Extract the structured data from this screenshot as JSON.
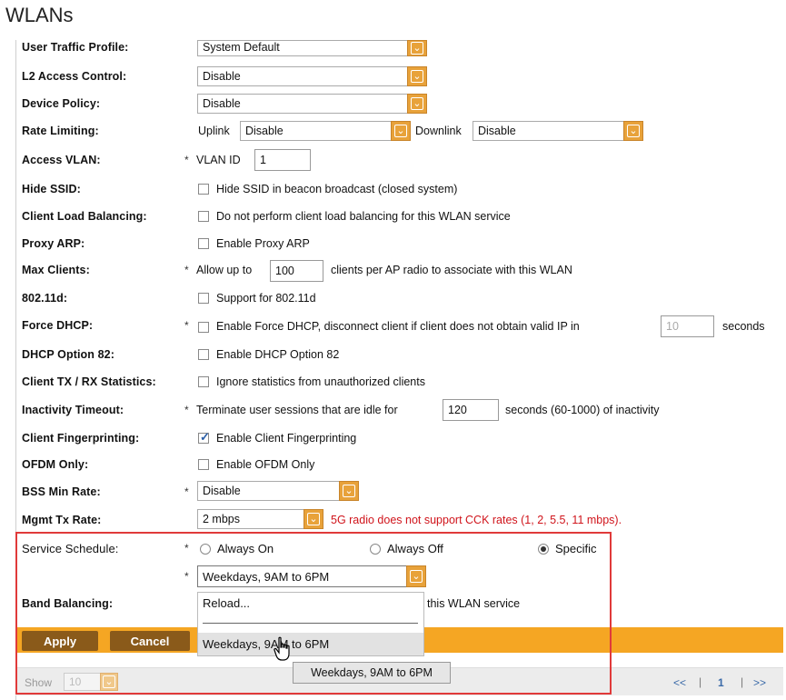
{
  "page": {
    "title": "WLANs"
  },
  "form": {
    "user_traffic_profile": {
      "label": "User Traffic Profile:",
      "value": "System Default"
    },
    "l2_access_control": {
      "label": "L2 Access Control:",
      "value": "Disable"
    },
    "device_policy": {
      "label": "Device Policy:",
      "value": "Disable"
    },
    "rate_limiting": {
      "label": "Rate Limiting:",
      "uplink_label": "Uplink",
      "uplink_value": "Disable",
      "downlink_label": "Downlink",
      "downlink_value": "Disable"
    },
    "access_vlan": {
      "label": "Access VLAN:",
      "star": "*",
      "vlan_id_label": "VLAN ID",
      "value": "1"
    },
    "hide_ssid": {
      "label": "Hide SSID:",
      "text": "Hide SSID in beacon broadcast (closed system)",
      "checked": false
    },
    "client_load_balancing": {
      "label": "Client Load Balancing:",
      "text": "Do not perform client load balancing for this WLAN service",
      "checked": false
    },
    "proxy_arp": {
      "label": "Proxy ARP:",
      "text": "Enable Proxy ARP",
      "checked": false
    },
    "max_clients": {
      "label": "Max Clients:",
      "star": "*",
      "prefix": "Allow up to",
      "value": "100",
      "suffix": "clients per AP radio to associate with this WLAN"
    },
    "dot11d": {
      "label": "802.11d:",
      "text": "Support for 802.11d",
      "checked": false
    },
    "force_dhcp": {
      "label": "Force DHCP:",
      "star": "*",
      "text": "Enable Force DHCP, disconnect client if client does not obtain valid IP in",
      "value": "10",
      "suffix": "seconds",
      "checked": false
    },
    "dhcp_option_82": {
      "label": "DHCP Option 82:",
      "text": "Enable DHCP Option 82",
      "checked": false
    },
    "client_stats": {
      "label": "Client TX / RX Statistics:",
      "text": "Ignore statistics from unauthorized clients",
      "checked": false
    },
    "inactivity_timeout": {
      "label": "Inactivity Timeout:",
      "star": "*",
      "prefix": "Terminate user sessions that are idle for",
      "value": "120",
      "suffix": "seconds (60-1000) of inactivity"
    },
    "client_fingerprinting": {
      "label": "Client Fingerprinting:",
      "text": "Enable Client Fingerprinting",
      "checked": true
    },
    "ofdm_only": {
      "label": "OFDM Only:",
      "text": "Enable OFDM Only",
      "checked": false
    },
    "bss_min_rate": {
      "label": "BSS Min Rate:",
      "star": "*",
      "value": "Disable"
    },
    "mgmt_tx_rate": {
      "label": "Mgmt Tx Rate:",
      "value": "2 mbps",
      "warning": "5G radio does not support CCK rates (1, 2, 5.5, 11 mbps)."
    },
    "service_schedule": {
      "label": "Service Schedule:",
      "star": "*",
      "always_on": "Always On",
      "always_off": "Always Off",
      "specific": "Specific",
      "selected": "Specific",
      "schedule_star": "*",
      "schedule_value": "Weekdays, 9AM to 6PM"
    },
    "band_balancing": {
      "label": "Band Balancing:",
      "text_tail": "this WLAN service"
    }
  },
  "dropdown": {
    "options": [
      "Reload...",
      "Weekdays, 9AM to 6PM"
    ],
    "highlighted": "Weekdays, 9AM to 6PM"
  },
  "tooltip": {
    "text": "Weekdays, 9AM to 6PM"
  },
  "actions": {
    "apply": "Apply",
    "cancel": "Cancel"
  },
  "footer": {
    "show_label": "Show",
    "show_value": "10",
    "prev": "<<",
    "separator1": "|",
    "page": "1",
    "separator2": "|",
    "next": ">>"
  },
  "colors": {
    "accent": "#f5a623",
    "button": "#8a5a1a",
    "warning": "#d0141b",
    "highlight_box": "#e03a3a"
  }
}
